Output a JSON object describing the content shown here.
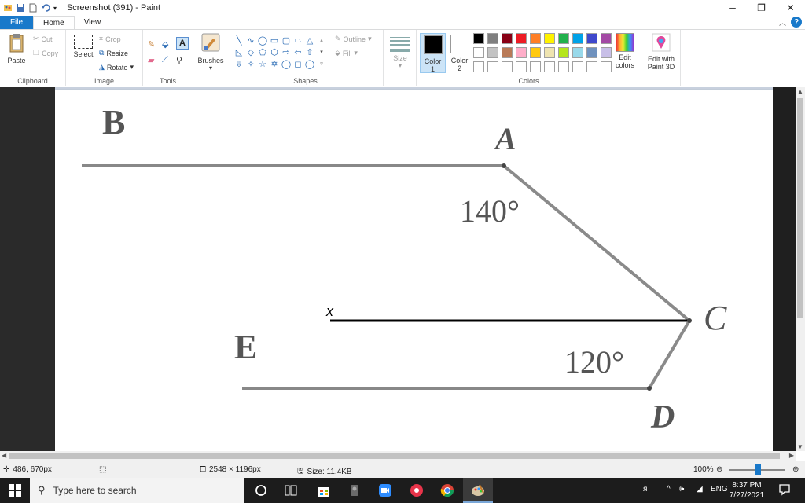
{
  "window": {
    "title": "Screenshot (391) - Paint",
    "minimize": "─",
    "maximize": "❐",
    "close": "✕"
  },
  "tabs": {
    "file": "File",
    "home": "Home",
    "view": "View"
  },
  "ribbon": {
    "clipboard": {
      "label": "Clipboard",
      "paste": "Paste",
      "cut": "Cut",
      "copy": "Copy"
    },
    "image": {
      "label": "Image",
      "select": "Select",
      "crop": "Crop",
      "resize": "Resize",
      "rotate": "Rotate"
    },
    "tools": {
      "label": "Tools",
      "text_tool": "A"
    },
    "brushes": {
      "label": "Brushes"
    },
    "shapes": {
      "label": "Shapes",
      "outline": "Outline",
      "fill": "Fill",
      "glyphs": [
        "╲",
        "∿",
        "◯",
        "▭",
        "▢",
        "⏢",
        "△",
        "◺",
        "◇",
        "⬠",
        "⬡",
        "⇨",
        "⇦",
        "⇧",
        "⇩",
        "✧",
        "☆",
        "✡",
        "◯",
        "◻",
        "◯"
      ]
    },
    "size": {
      "label": "Size"
    },
    "colors": {
      "label": "Colors",
      "color1_label": "Color",
      "color1_num": "1",
      "color2_label": "Color",
      "color2_num": "2",
      "color1": "#000000",
      "color2": "#ffffff",
      "edit_colors_1": "Edit",
      "edit_colors_2": "colors",
      "paint3d_1": "Edit with",
      "paint3d_2": "Paint 3D",
      "palette": [
        "#000000",
        "#7f7f7f",
        "#880015",
        "#ed1c24",
        "#ff7f27",
        "#fff200",
        "#22b14c",
        "#00a2e8",
        "#3f48cc",
        "#a349a4",
        "#ffffff",
        "#c3c3c3",
        "#b97a57",
        "#ffaec9",
        "#ffc90e",
        "#efe4b0",
        "#b5e61d",
        "#99d9ea",
        "#7092be",
        "#c8bfe7",
        "#ffffff",
        "#ffffff",
        "#ffffff",
        "#ffffff",
        "#ffffff",
        "#ffffff",
        "#ffffff",
        "#ffffff",
        "#ffffff",
        "#ffffff"
      ]
    }
  },
  "canvas": {
    "label_B": "B",
    "label_A": "A",
    "label_C": "C",
    "label_D": "D",
    "label_E": "E",
    "label_x": "x",
    "angle_A": "140°",
    "angle_D": "120°"
  },
  "status": {
    "cursor": "486, 670px",
    "dimensions": "2548 × 1196px",
    "size": "Size: 11.4KB",
    "zoom": "100%"
  },
  "taskbar": {
    "search_placeholder": "Type here to search",
    "language": "ENG",
    "time": "8:37 PM",
    "date": "7/27/2021"
  }
}
